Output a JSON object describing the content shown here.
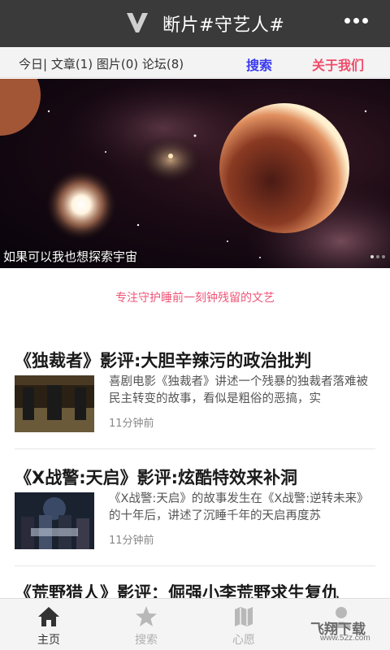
{
  "header": {
    "title": "断片#守艺人#"
  },
  "nav": {
    "left_text": "今日| 文章(1)  图片(0) 论坛(8)",
    "search_label": "搜索",
    "about_label": "关于我们"
  },
  "banner": {
    "caption": "如果可以我也想探索宇宙"
  },
  "tagline": "专注守护睡前一刻钟残留的文艺",
  "articles": [
    {
      "title": "《独裁者》影评:大胆辛辣污的政治批判",
      "desc": "喜剧电影《独裁者》讲述一个残暴的独裁者落难被民主转变的故事，看似是粗俗的恶搞，实",
      "time": "11分钟前"
    },
    {
      "title": "《X战警:天启》影评:炫酷特效来补洞",
      "desc": "《X战警:天启》的故事发生在《X战警:逆转未来》的十年后，讲述了沉睡千年的天启再度苏",
      "time": "11分钟前"
    },
    {
      "title": "《荒野猎人》影评：倔强小李荒野求生复仇"
    }
  ],
  "tabs": [
    {
      "label": "主页",
      "icon": "home-icon"
    },
    {
      "label": "搜索",
      "icon": "star-icon"
    },
    {
      "label": "心愿",
      "icon": "map-icon"
    },
    {
      "label": "",
      "icon": "person-icon"
    }
  ],
  "watermark": {
    "text": "飞翔下载",
    "url": "www.52z.com"
  },
  "colors": {
    "topbar": "#3a3a3a",
    "search": "#3a3af0",
    "about": "#f04a6a",
    "tagline": "#ee5577"
  }
}
